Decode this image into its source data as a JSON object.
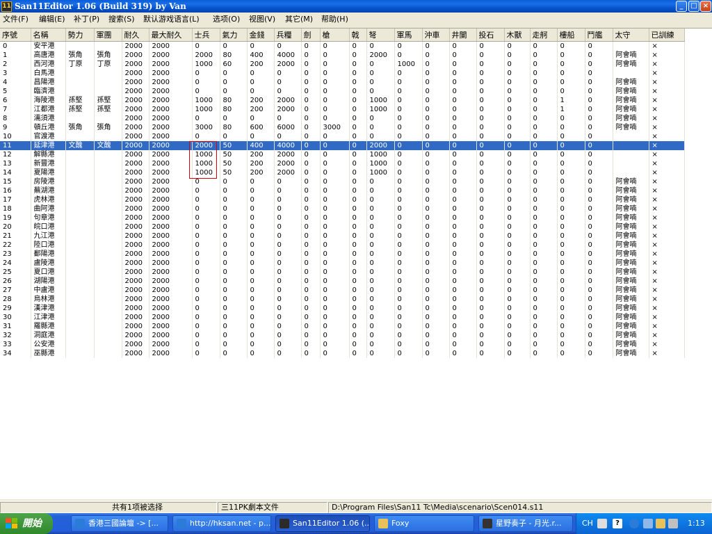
{
  "window": {
    "title": "San11Editor 1.06 (Build 319) by Van",
    "app_icon_text": "11"
  },
  "menu": [
    "文件(F)",
    "编辑(E)",
    "补丁(P)",
    "搜索(S)",
    "默认游戏语言(L)",
    "选项(O)",
    "视图(V)",
    "其它(M)",
    "帮助(H)"
  ],
  "grid": {
    "columns": [
      "序號",
      "名稱",
      "勢力",
      "軍團",
      "耐久",
      "最大耐久",
      "士兵",
      "氣力",
      "金錢",
      "兵糧",
      "劍",
      "槍",
      "戟",
      "弩",
      "軍馬",
      "沖車",
      "井闌",
      "投石",
      "木獸",
      "走舸",
      "樓船",
      "鬥艦",
      "太守",
      "已訓練"
    ],
    "selected_row": 11,
    "rows": [
      [
        "0",
        "安平港",
        "",
        "",
        "2000",
        "2000",
        "0",
        "0",
        "0",
        "0",
        "0",
        "0",
        "0",
        "0",
        "0",
        "0",
        "0",
        "0",
        "0",
        "0",
        "0",
        "0",
        "",
        "×"
      ],
      [
        "1",
        "高唐港",
        "張角",
        "張角",
        "2000",
        "2000",
        "2000",
        "80",
        "400",
        "4000",
        "0",
        "0",
        "0",
        "2000",
        "0",
        "0",
        "0",
        "0",
        "0",
        "0",
        "0",
        "0",
        "阿會喃",
        "×"
      ],
      [
        "2",
        "西河港",
        "丁原",
        "丁原",
        "2000",
        "2000",
        "1000",
        "60",
        "200",
        "2000",
        "0",
        "0",
        "0",
        "0",
        "1000",
        "0",
        "0",
        "0",
        "0",
        "0",
        "0",
        "0",
        "阿會喃",
        "×"
      ],
      [
        "3",
        "白馬港",
        "",
        "",
        "2000",
        "2000",
        "0",
        "0",
        "0",
        "0",
        "0",
        "0",
        "0",
        "0",
        "0",
        "0",
        "0",
        "0",
        "0",
        "0",
        "0",
        "0",
        "",
        "×"
      ],
      [
        "4",
        "昌陽港",
        "",
        "",
        "2000",
        "2000",
        "0",
        "0",
        "0",
        "0",
        "0",
        "0",
        "0",
        "0",
        "0",
        "0",
        "0",
        "0",
        "0",
        "0",
        "0",
        "0",
        "阿會喃",
        "×"
      ],
      [
        "5",
        "臨濟港",
        "",
        "",
        "2000",
        "2000",
        "0",
        "0",
        "0",
        "0",
        "0",
        "0",
        "0",
        "0",
        "0",
        "0",
        "0",
        "0",
        "0",
        "0",
        "0",
        "0",
        "阿會喃",
        "×"
      ],
      [
        "6",
        "海陵港",
        "孫堅",
        "孫堅",
        "2000",
        "2000",
        "1000",
        "80",
        "200",
        "2000",
        "0",
        "0",
        "0",
        "1000",
        "0",
        "0",
        "0",
        "0",
        "0",
        "0",
        "1",
        "0",
        "阿會喃",
        "×"
      ],
      [
        "7",
        "江都港",
        "孫堅",
        "孫堅",
        "2000",
        "2000",
        "1000",
        "80",
        "200",
        "2000",
        "0",
        "0",
        "0",
        "1000",
        "0",
        "0",
        "0",
        "0",
        "0",
        "0",
        "1",
        "0",
        "阿會喃",
        "×"
      ],
      [
        "8",
        "濡須港",
        "",
        "",
        "2000",
        "2000",
        "0",
        "0",
        "0",
        "0",
        "0",
        "0",
        "0",
        "0",
        "0",
        "0",
        "0",
        "0",
        "0",
        "0",
        "0",
        "0",
        "阿會喃",
        "×"
      ],
      [
        "9",
        "頓丘港",
        "張角",
        "張角",
        "2000",
        "2000",
        "3000",
        "80",
        "600",
        "6000",
        "0",
        "3000",
        "0",
        "0",
        "0",
        "0",
        "0",
        "0",
        "0",
        "0",
        "0",
        "0",
        "阿會喃",
        "×"
      ],
      [
        "10",
        "官渡港",
        "",
        "",
        "2000",
        "2000",
        "0",
        "0",
        "0",
        "0",
        "0",
        "0",
        "0",
        "0",
        "0",
        "0",
        "0",
        "0",
        "0",
        "0",
        "0",
        "0",
        "",
        "×"
      ],
      [
        "11",
        "延津港",
        "文醜",
        "文醜",
        "2000",
        "2000",
        "2000",
        "50",
        "400",
        "4000",
        "0",
        "0",
        "0",
        "2000",
        "0",
        "0",
        "0",
        "0",
        "0",
        "0",
        "0",
        "0",
        "",
        "×"
      ],
      [
        "12",
        "解縣港",
        "",
        "",
        "2000",
        "2000",
        "1000",
        "50",
        "200",
        "2000",
        "0",
        "0",
        "0",
        "1000",
        "0",
        "0",
        "0",
        "0",
        "0",
        "0",
        "0",
        "0",
        "",
        "×"
      ],
      [
        "13",
        "新豐港",
        "",
        "",
        "2000",
        "2000",
        "1000",
        "50",
        "200",
        "2000",
        "0",
        "0",
        "0",
        "1000",
        "0",
        "0",
        "0",
        "0",
        "0",
        "0",
        "0",
        "0",
        "",
        "×"
      ],
      [
        "14",
        "夏陽港",
        "",
        "",
        "2000",
        "2000",
        "1000",
        "50",
        "200",
        "2000",
        "0",
        "0",
        "0",
        "1000",
        "0",
        "0",
        "0",
        "0",
        "0",
        "0",
        "0",
        "0",
        "",
        "×"
      ],
      [
        "15",
        "房陵港",
        "",
        "",
        "2000",
        "2000",
        "0",
        "0",
        "0",
        "0",
        "0",
        "0",
        "0",
        "0",
        "0",
        "0",
        "0",
        "0",
        "0",
        "0",
        "0",
        "0",
        "阿會喃",
        "×"
      ],
      [
        "16",
        "蕪湖港",
        "",
        "",
        "2000",
        "2000",
        "0",
        "0",
        "0",
        "0",
        "0",
        "0",
        "0",
        "0",
        "0",
        "0",
        "0",
        "0",
        "0",
        "0",
        "0",
        "0",
        "阿會喃",
        "×"
      ],
      [
        "17",
        "虎林港",
        "",
        "",
        "2000",
        "2000",
        "0",
        "0",
        "0",
        "0",
        "0",
        "0",
        "0",
        "0",
        "0",
        "0",
        "0",
        "0",
        "0",
        "0",
        "0",
        "0",
        "阿會喃",
        "×"
      ],
      [
        "18",
        "曲阿港",
        "",
        "",
        "2000",
        "2000",
        "0",
        "0",
        "0",
        "0",
        "0",
        "0",
        "0",
        "0",
        "0",
        "0",
        "0",
        "0",
        "0",
        "0",
        "0",
        "0",
        "阿會喃",
        "×"
      ],
      [
        "19",
        "句章港",
        "",
        "",
        "2000",
        "2000",
        "0",
        "0",
        "0",
        "0",
        "0",
        "0",
        "0",
        "0",
        "0",
        "0",
        "0",
        "0",
        "0",
        "0",
        "0",
        "0",
        "阿會喃",
        "×"
      ],
      [
        "20",
        "皖口港",
        "",
        "",
        "2000",
        "2000",
        "0",
        "0",
        "0",
        "0",
        "0",
        "0",
        "0",
        "0",
        "0",
        "0",
        "0",
        "0",
        "0",
        "0",
        "0",
        "0",
        "阿會喃",
        "×"
      ],
      [
        "21",
        "九江港",
        "",
        "",
        "2000",
        "2000",
        "0",
        "0",
        "0",
        "0",
        "0",
        "0",
        "0",
        "0",
        "0",
        "0",
        "0",
        "0",
        "0",
        "0",
        "0",
        "0",
        "阿會喃",
        "×"
      ],
      [
        "22",
        "陸口港",
        "",
        "",
        "2000",
        "2000",
        "0",
        "0",
        "0",
        "0",
        "0",
        "0",
        "0",
        "0",
        "0",
        "0",
        "0",
        "0",
        "0",
        "0",
        "0",
        "0",
        "阿會喃",
        "×"
      ],
      [
        "23",
        "鄱陽港",
        "",
        "",
        "2000",
        "2000",
        "0",
        "0",
        "0",
        "0",
        "0",
        "0",
        "0",
        "0",
        "0",
        "0",
        "0",
        "0",
        "0",
        "0",
        "0",
        "0",
        "阿會喃",
        "×"
      ],
      [
        "24",
        "盧陵港",
        "",
        "",
        "2000",
        "2000",
        "0",
        "0",
        "0",
        "0",
        "0",
        "0",
        "0",
        "0",
        "0",
        "0",
        "0",
        "0",
        "0",
        "0",
        "0",
        "0",
        "阿會喃",
        "×"
      ],
      [
        "25",
        "夏口港",
        "",
        "",
        "2000",
        "2000",
        "0",
        "0",
        "0",
        "0",
        "0",
        "0",
        "0",
        "0",
        "0",
        "0",
        "0",
        "0",
        "0",
        "0",
        "0",
        "0",
        "阿會喃",
        "×"
      ],
      [
        "26",
        "湖陽港",
        "",
        "",
        "2000",
        "2000",
        "0",
        "0",
        "0",
        "0",
        "0",
        "0",
        "0",
        "0",
        "0",
        "0",
        "0",
        "0",
        "0",
        "0",
        "0",
        "0",
        "阿會喃",
        "×"
      ],
      [
        "27",
        "中盧港",
        "",
        "",
        "2000",
        "2000",
        "0",
        "0",
        "0",
        "0",
        "0",
        "0",
        "0",
        "0",
        "0",
        "0",
        "0",
        "0",
        "0",
        "0",
        "0",
        "0",
        "阿會喃",
        "×"
      ],
      [
        "28",
        "烏林港",
        "",
        "",
        "2000",
        "2000",
        "0",
        "0",
        "0",
        "0",
        "0",
        "0",
        "0",
        "0",
        "0",
        "0",
        "0",
        "0",
        "0",
        "0",
        "0",
        "0",
        "阿會喃",
        "×"
      ],
      [
        "29",
        "漢津港",
        "",
        "",
        "2000",
        "2000",
        "0",
        "0",
        "0",
        "0",
        "0",
        "0",
        "0",
        "0",
        "0",
        "0",
        "0",
        "0",
        "0",
        "0",
        "0",
        "0",
        "阿會喃",
        "×"
      ],
      [
        "30",
        "江津港",
        "",
        "",
        "2000",
        "2000",
        "0",
        "0",
        "0",
        "0",
        "0",
        "0",
        "0",
        "0",
        "0",
        "0",
        "0",
        "0",
        "0",
        "0",
        "0",
        "0",
        "阿會喃",
        "×"
      ],
      [
        "31",
        "羅縣港",
        "",
        "",
        "2000",
        "2000",
        "0",
        "0",
        "0",
        "0",
        "0",
        "0",
        "0",
        "0",
        "0",
        "0",
        "0",
        "0",
        "0",
        "0",
        "0",
        "0",
        "阿會喃",
        "×"
      ],
      [
        "32",
        "洞庭港",
        "",
        "",
        "2000",
        "2000",
        "0",
        "0",
        "0",
        "0",
        "0",
        "0",
        "0",
        "0",
        "0",
        "0",
        "0",
        "0",
        "0",
        "0",
        "0",
        "0",
        "阿會喃",
        "×"
      ],
      [
        "33",
        "公安港",
        "",
        "",
        "2000",
        "2000",
        "0",
        "0",
        "0",
        "0",
        "0",
        "0",
        "0",
        "0",
        "0",
        "0",
        "0",
        "0",
        "0",
        "0",
        "0",
        "0",
        "阿會喃",
        "×"
      ],
      [
        "34",
        "巫縣港",
        "",
        "",
        "2000",
        "2000",
        "0",
        "0",
        "0",
        "0",
        "0",
        "0",
        "0",
        "0",
        "0",
        "0",
        "0",
        "0",
        "0",
        "0",
        "0",
        "0",
        "阿會喃",
        "×"
      ]
    ]
  },
  "status": {
    "selection": "共有1项被选择",
    "file_type": "三11PK劇本文件",
    "file_path": "D:\\Program Files\\San11 Tc\\Media\\scenario\\Scen014.s11"
  },
  "taskbar": {
    "start_label": "開始",
    "tasks": [
      {
        "label": "香港三國論壇 -> [...",
        "icon": "ie-icon",
        "color": "#2b7bd8"
      },
      {
        "label": "http://hksan.net - p...",
        "icon": "ie-icon",
        "color": "#2b7bd8"
      },
      {
        "label": "San11Editor 1.06 (...",
        "icon": "san11-icon",
        "color": "#2b2b2b",
        "active": true
      },
      {
        "label": "Foxy",
        "icon": "folder-icon",
        "color": "#e8c15a"
      },
      {
        "label": "星野奏子 - 月光.r...",
        "icon": "media-player-icon",
        "color": "#333"
      }
    ],
    "tray": {
      "ime": "CH",
      "clock": "1:13"
    }
  },
  "colors": {
    "selection": "#316ac5",
    "highlight_box": "#dd0000",
    "titlebar": "#0451c9",
    "taskbar": "#245edb"
  }
}
